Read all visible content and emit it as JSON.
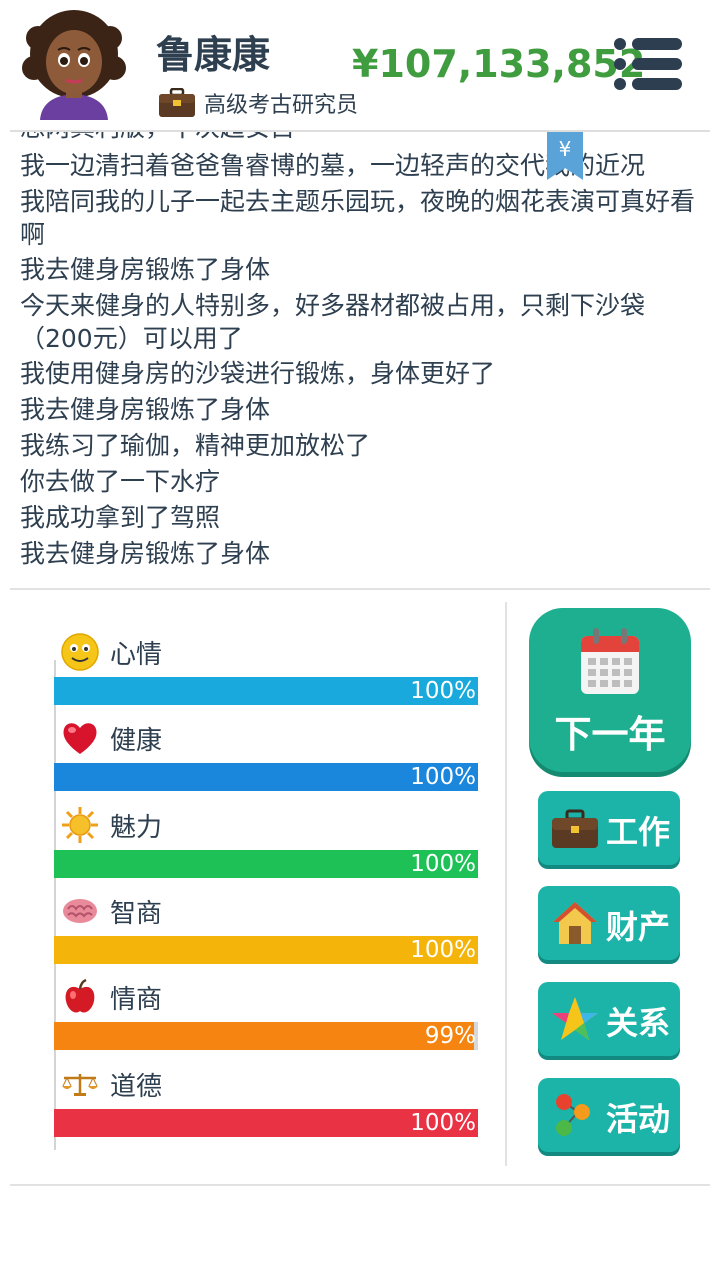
{
  "header": {
    "name": "鲁康康",
    "job": "高级考古研究员",
    "money": "¥107,133,852",
    "icons": {
      "avatar": "avatar-woman",
      "job": "briefcase-icon",
      "menu": "menu-icon"
    }
  },
  "log": {
    "partial_line": "恐两其利版，干次超安占",
    "lines": [
      "我一边清扫着爸爸鲁睿博的墓，一边轻声的交代我的近况",
      "我陪同我的儿子一起去主题乐园玩，夜晚的烟花表演可真好看啊",
      "我去健身房锻炼了身体",
      "今天来健身的人特别多，好多器材都被占用，只剩下沙袋（200元）可以用了",
      "我使用健身房的沙袋进行锻炼，身体更好了",
      "我去健身房锻炼了身体",
      "我练习了瑜伽，精神更加放松了",
      "你去做了一下水疗",
      "我成功拿到了驾照",
      "我去健身房锻炼了身体"
    ],
    "bookmark_symbol": "¥"
  },
  "stats": [
    {
      "label": "心情",
      "value": 100,
      "display": "100%",
      "color": "#1aa9dc",
      "icon": "smiley-icon"
    },
    {
      "label": "健康",
      "value": 100,
      "display": "100%",
      "color": "#1a86dc",
      "icon": "heart-icon"
    },
    {
      "label": "魅力",
      "value": 100,
      "display": "100%",
      "color": "#1ec156",
      "icon": "sun-icon"
    },
    {
      "label": "智商",
      "value": 100,
      "display": "100%",
      "color": "#f4b40a",
      "icon": "brain-icon"
    },
    {
      "label": "情商",
      "value": 99,
      "display": "99%",
      "color": "#f58510",
      "icon": "apple-icon"
    },
    {
      "label": "道德",
      "value": 100,
      "display": "100%",
      "color": "#ea3245",
      "icon": "scales-icon"
    }
  ],
  "actions": {
    "next_year": "下一年",
    "work": "工作",
    "property": "财产",
    "relations": "关系",
    "activities": "活动"
  },
  "colors": {
    "next_button": "#1daf8f",
    "side_button": "#1cb4a8",
    "money": "#3f9c3f",
    "text": "#2e3f50"
  }
}
